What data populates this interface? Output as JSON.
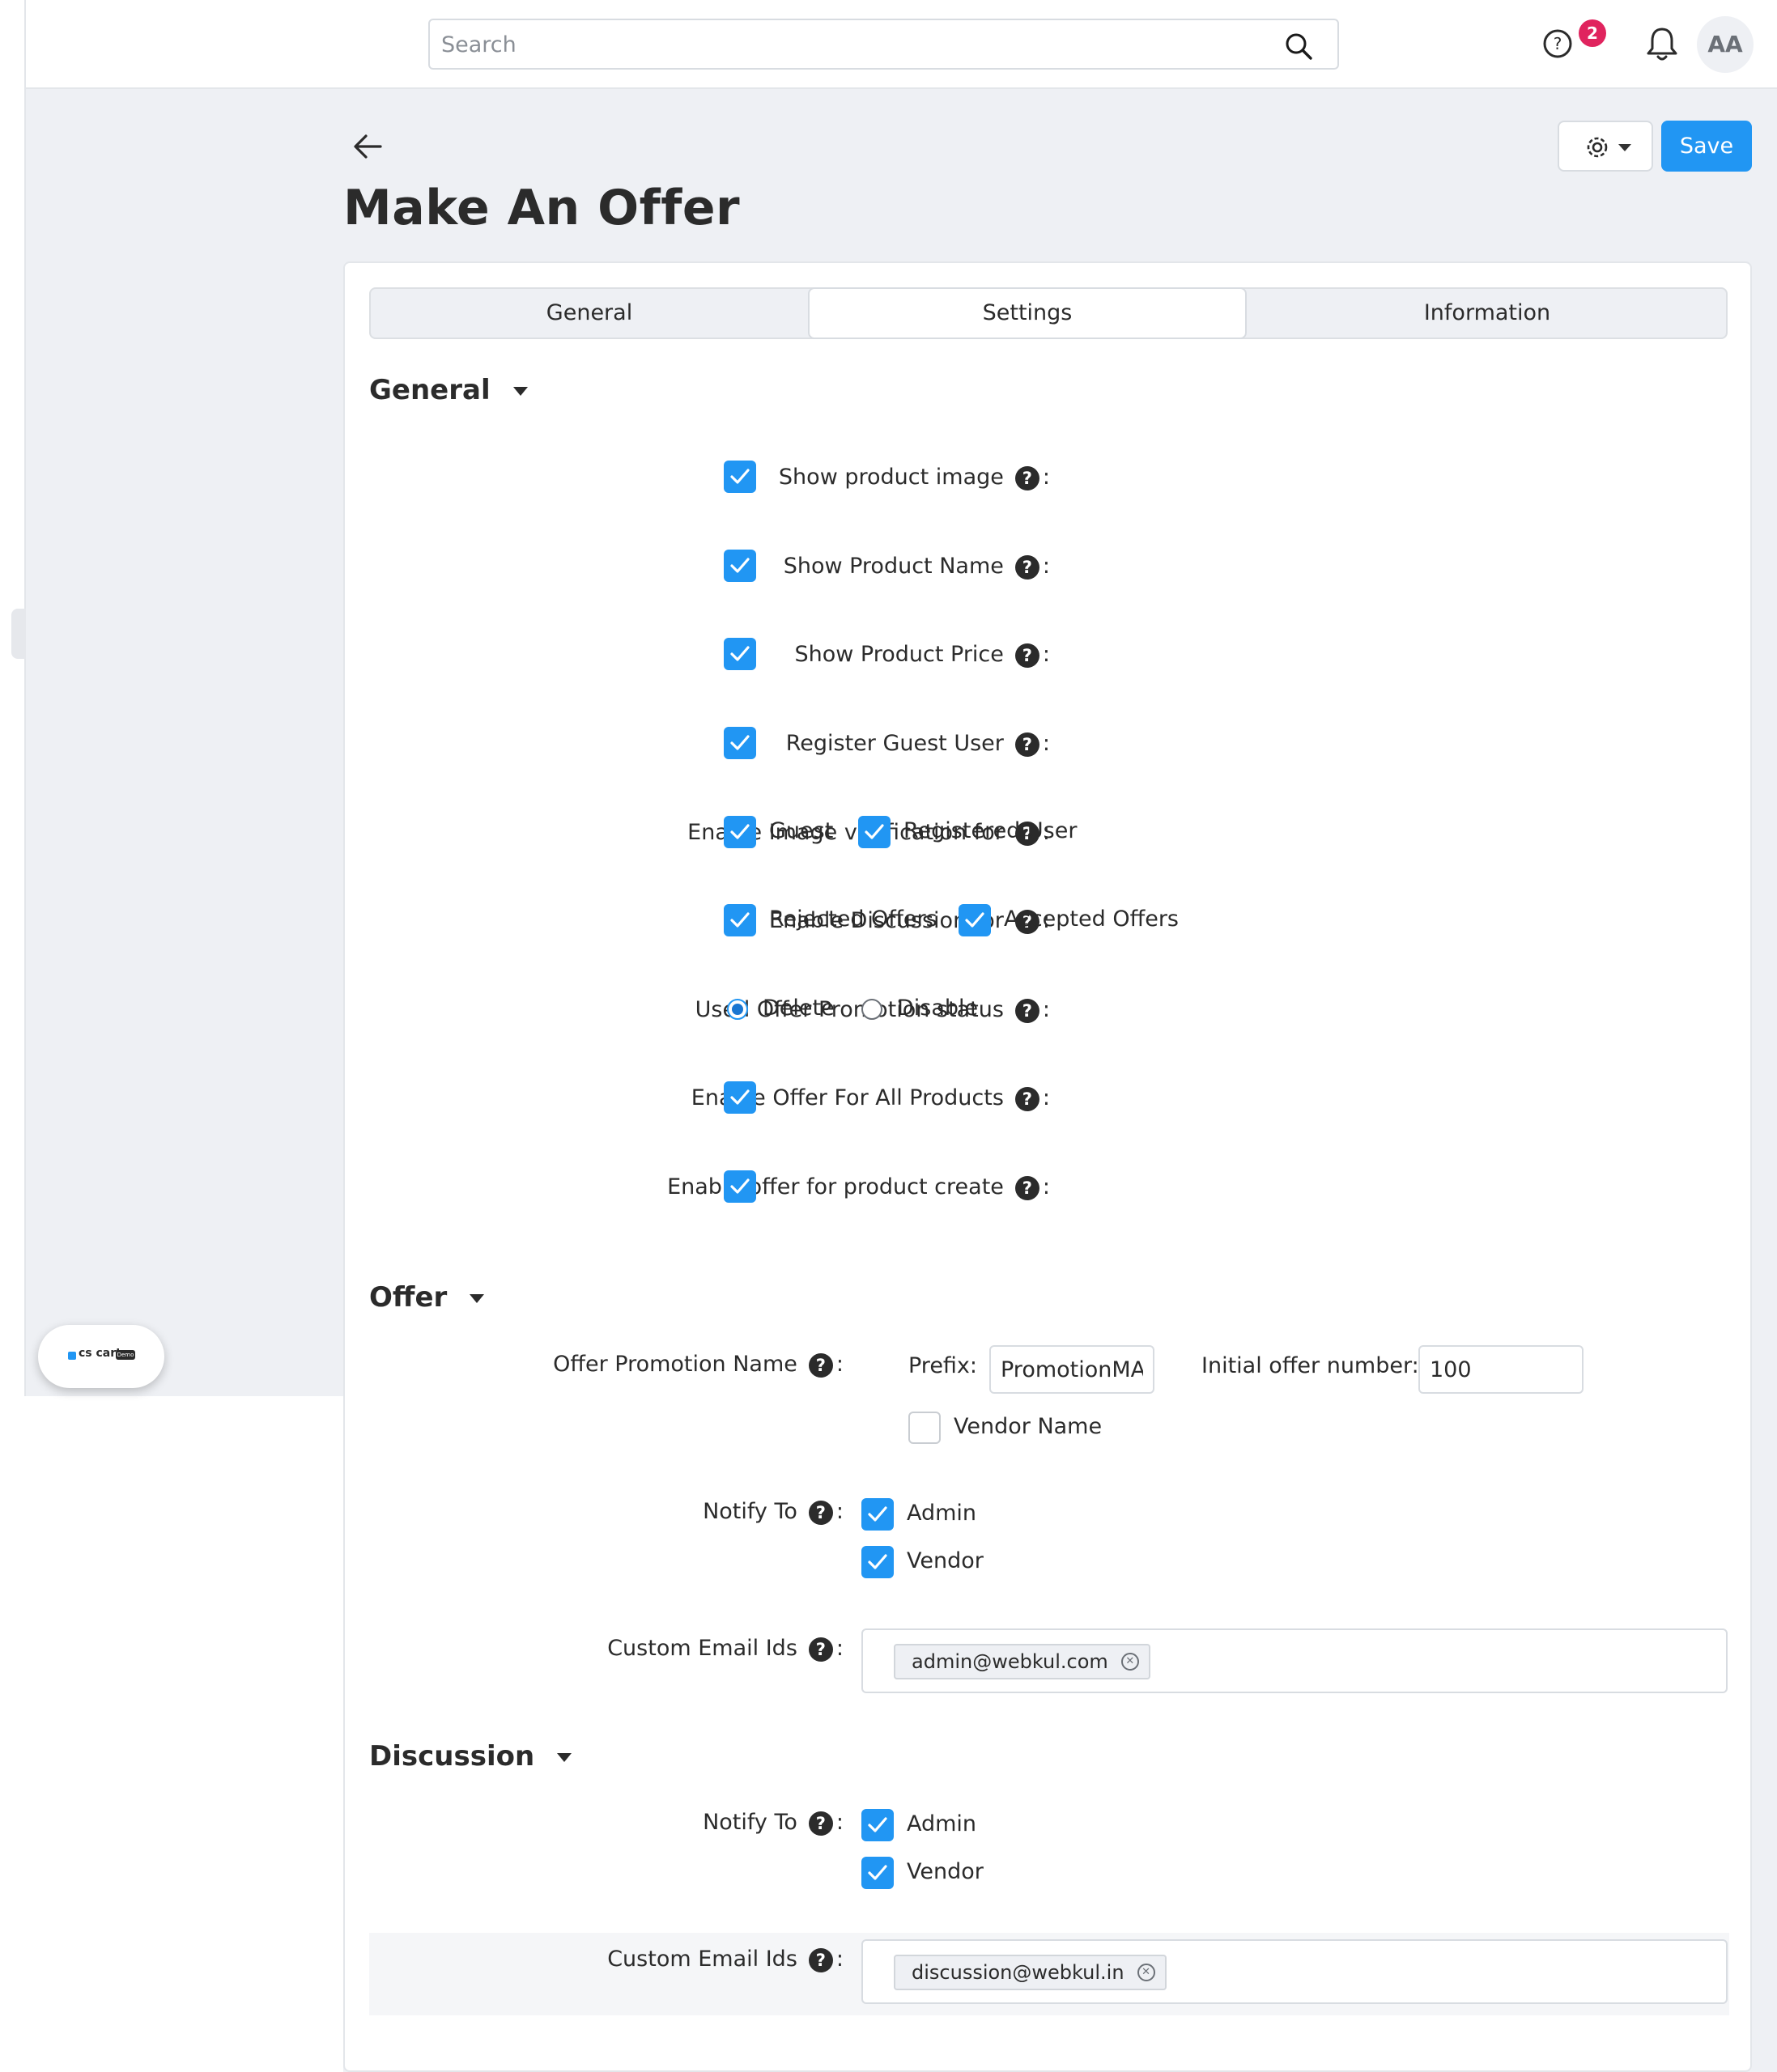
{
  "topbar": {
    "search_placeholder": "Search",
    "help_badge_count": "2",
    "avatar_initials": "AA",
    "icons": [
      "search-icon",
      "help-icon",
      "bell-icon"
    ]
  },
  "header": {
    "title": "Make An Offer",
    "save_label": "Save",
    "icons": [
      "back-arrow-icon",
      "gear-icon"
    ]
  },
  "tabs": [
    {
      "label": "General",
      "active": false
    },
    {
      "label": "Settings",
      "active": true
    },
    {
      "label": "Information",
      "active": false
    }
  ],
  "general": {
    "heading": "General",
    "rows": [
      {
        "label": "Show product image",
        "checked": true
      },
      {
        "label": "Show Product Name",
        "checked": true
      },
      {
        "label": "Show Product Price",
        "checked": true
      },
      {
        "label": "Register Guest User",
        "checked": true
      },
      {
        "label": "Enable Image verification for",
        "options": [
          {
            "label": "Guest",
            "checked": true
          },
          {
            "label": "Registered User",
            "checked": true
          }
        ]
      },
      {
        "label": "Enable Discussion for",
        "options": [
          {
            "label": "Rejected Offers",
            "checked": true
          },
          {
            "label": "Accepted Offers",
            "checked": true
          }
        ]
      },
      {
        "label": "Used Offer Promotion status",
        "radios": [
          {
            "label": "Delete",
            "selected": true
          },
          {
            "label": "Disable",
            "selected": false
          }
        ]
      },
      {
        "label": "Enable Offer For All Products",
        "checked": true
      },
      {
        "label": "Enable offer for product create",
        "checked": true
      }
    ]
  },
  "offer": {
    "heading": "Offer",
    "promotion_name_label": "Offer Promotion Name",
    "prefix_label": "Prefix:",
    "prefix_value": "PromotionMA",
    "initial_number_label": "Initial offer number:",
    "initial_number_value": "100",
    "vendor_name_label": "Vendor Name",
    "vendor_name_checked": false,
    "notify_label": "Notify To",
    "notify_admin": "Admin",
    "notify_vendor": "Vendor",
    "email_label": "Custom Email Ids",
    "email_chip": "admin@webkul.com"
  },
  "discussion": {
    "heading": "Discussion",
    "notify_label": "Notify To",
    "notify_admin": "Admin",
    "notify_vendor": "Vendor",
    "email_label": "Custom Email Ids",
    "email_chip": "discussion@webkul.in"
  },
  "widget": {
    "logo_text": "cs cart",
    "logo_tag": "Demo"
  },
  "colors": {
    "accent": "#2196f3",
    "badge": "#e0245e",
    "page_bg": "#eef0f4"
  }
}
